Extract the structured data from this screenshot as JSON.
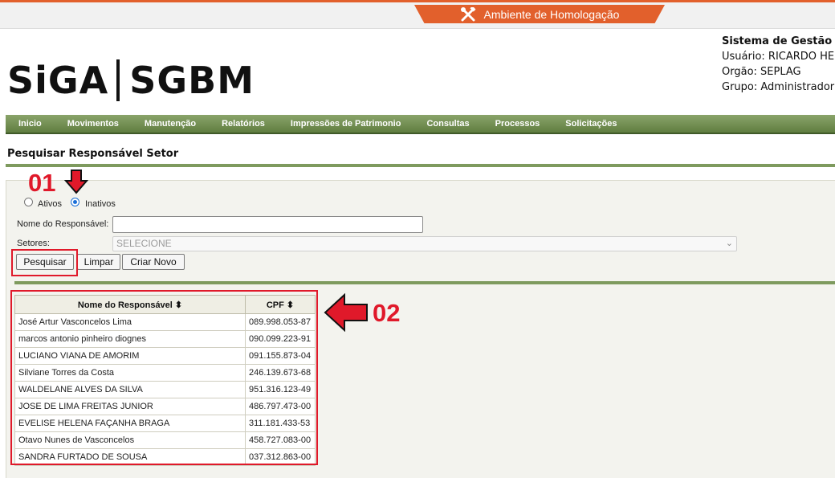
{
  "environment": {
    "label": "Ambiente de Homologação",
    "icon": "tools-icon",
    "color": "#e2602c"
  },
  "logo": {
    "left": "SiGA",
    "right": "SGBM"
  },
  "system_info": {
    "title": "Sistema de Gestão de",
    "user": "Usuário: RICARDO HEN",
    "org": "Orgão: SEPLAG",
    "group": "Grupo: Administrador"
  },
  "menu": [
    "Inicio",
    "Movimentos",
    "Manutenção",
    "Relatórios",
    "Impressões de Patrimonio",
    "Consultas",
    "Processos",
    "Solicitações"
  ],
  "page_title": "Pesquisar Responsável Setor",
  "filters": {
    "status_options": [
      "Ativos",
      "Inativos"
    ],
    "status_selected": "Inativos",
    "name_label": "Nome do Responsável:",
    "name_value": "",
    "sector_label": "Setores:",
    "sector_value": "SELECIONE"
  },
  "buttons": {
    "search": "Pesquisar",
    "clear": "Limpar",
    "new": "Criar Novo"
  },
  "table": {
    "headers": [
      "Nome do Responsável ⬍",
      "CPF ⬍"
    ],
    "rows": [
      [
        "José Artur Vasconcelos Lima",
        "089.998.053-87"
      ],
      [
        "marcos antonio pinheiro diognes",
        "090.099.223-91"
      ],
      [
        "LUCIANO VIANA DE AMORIM",
        "091.155.873-04"
      ],
      [
        "Silviane Torres da Costa",
        "246.139.673-68"
      ],
      [
        "WALDELANE ALVES DA SILVA",
        "951.316.123-49"
      ],
      [
        "JOSE DE LIMA FREITAS JUNIOR",
        "486.797.473-00"
      ],
      [
        "EVELISE HELENA FAÇANHA BRAGA",
        "311.181.433-53"
      ],
      [
        "Otavo Nunes de Vasconcelos",
        "458.727.083-00"
      ],
      [
        "SANDRA FURTADO DE SOUSA",
        "037.312.863-00"
      ]
    ]
  },
  "annotations": {
    "step1": "01",
    "step2": "02",
    "color": "#e0192a"
  }
}
